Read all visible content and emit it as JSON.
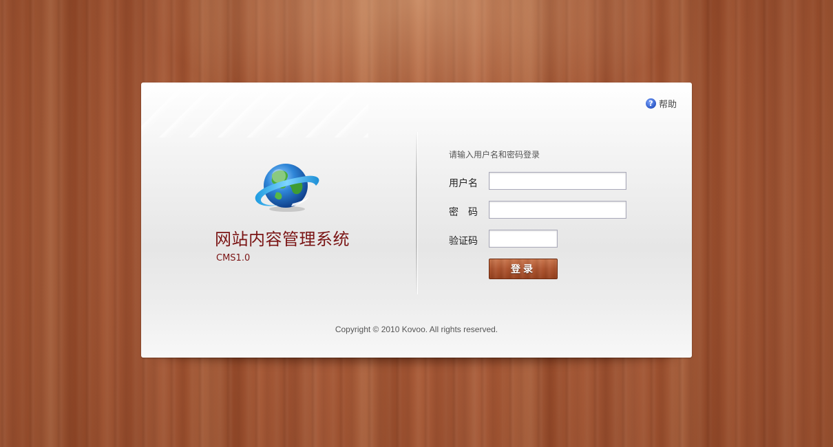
{
  "help": {
    "label": "帮助",
    "icon": "help-icon"
  },
  "brand": {
    "logo_icon": "globe-icon",
    "title": "网站内容管理系统",
    "version": "CMS1.0",
    "title_color": "#7a1414"
  },
  "login": {
    "hint": "请输入用户名和密码登录",
    "username_label": "用户名",
    "username_value": "",
    "password_label": "密　码",
    "password_value": "",
    "captcha_label": "验证码",
    "captcha_value": "",
    "submit_label": "登录"
  },
  "footer": {
    "copyright": "Copyright © 2010 Kovoo. All rights reserved."
  }
}
